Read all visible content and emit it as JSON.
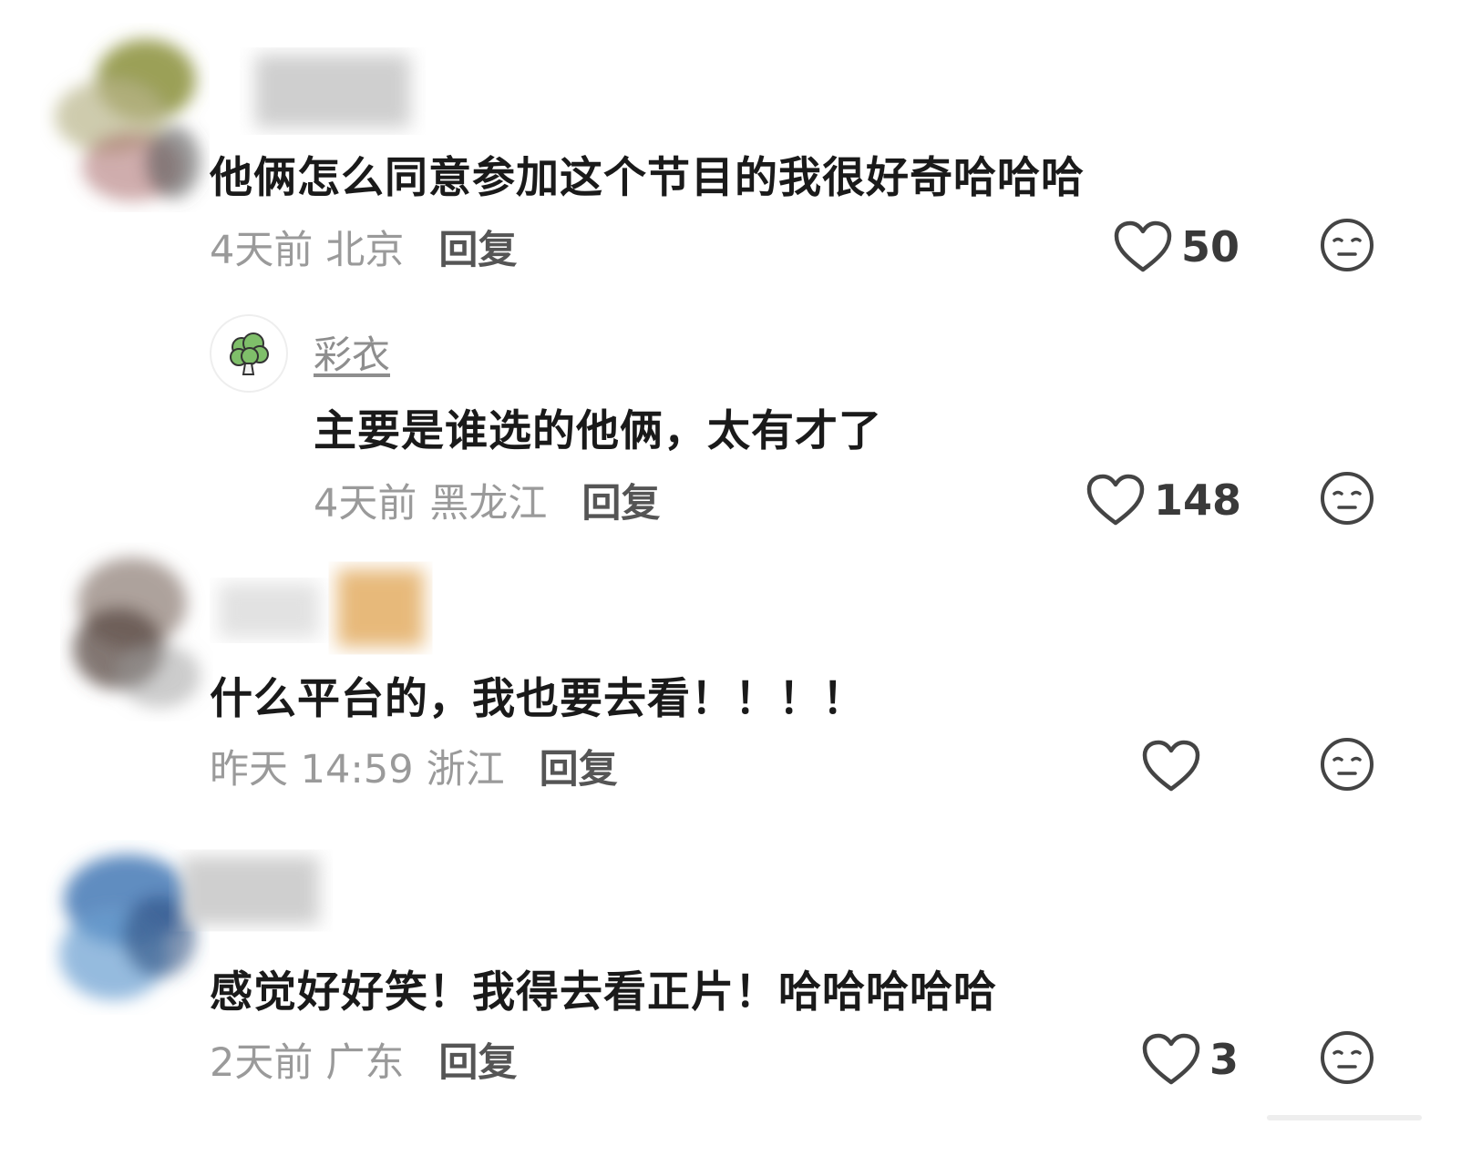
{
  "comments": [
    {
      "text": "他俩怎么同意参加这个节目的我很好奇哈哈哈",
      "time": "4天前",
      "location": "北京",
      "reply_label": "回复",
      "likes": "50",
      "avatar_color": "#8a8f3a",
      "name_blur_color": "#cfcfcf",
      "replies": [
        {
          "username": "彩衣",
          "avatar_icon": "broccoli-icon",
          "text": "主要是谁选的他俩，太有才了",
          "time": "4天前",
          "location": "黑龙江",
          "reply_label": "回复",
          "likes": "148"
        }
      ]
    },
    {
      "text": "什么平台的，我也要去看！！！！",
      "time": "昨天 14:59",
      "location": "浙江",
      "reply_label": "回复",
      "likes": "",
      "avatar_color": "#5a4a44",
      "name_blur_color": "#e7b97a"
    },
    {
      "text": "感觉好好笑！我得去看正片！哈哈哈哈哈",
      "time": "2天前",
      "location": "广东",
      "reply_label": "回复",
      "likes": "3",
      "avatar_color": "#3a6fb0",
      "name_blur_color": "#cfcfcf"
    }
  ],
  "colors": {
    "text": "#1a1a1a",
    "meta": "#9a9a9a",
    "icon": "#444444"
  }
}
